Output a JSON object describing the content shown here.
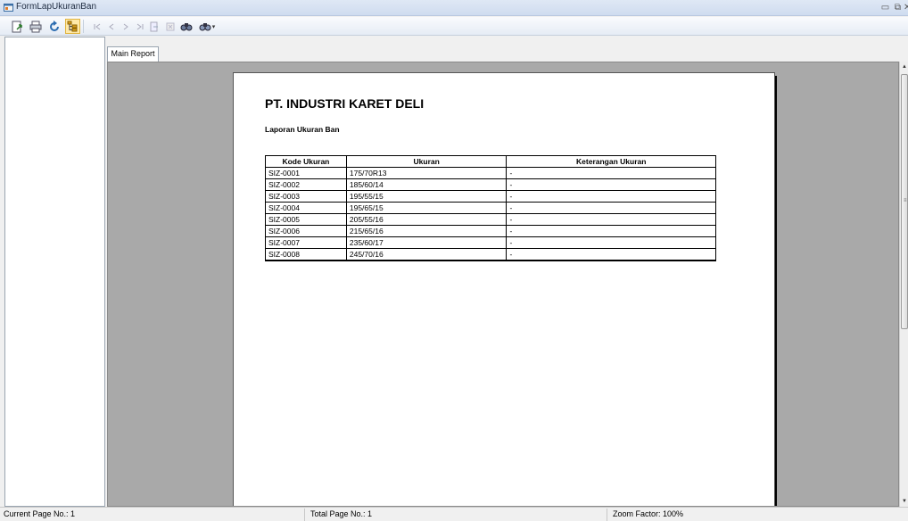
{
  "window": {
    "title": "FormLapUkuranBan",
    "controls": [
      "minimize-icon",
      "restore-icon",
      "close-icon"
    ]
  },
  "toolbar": {
    "buttons": [
      {
        "name": "export-icon",
        "enabled": true
      },
      {
        "name": "print-icon",
        "enabled": true
      },
      {
        "name": "refresh-icon",
        "enabled": true
      },
      {
        "name": "toggle-tree-icon",
        "enabled": true,
        "active": true
      },
      {
        "name": "first-page-icon",
        "enabled": false
      },
      {
        "name": "previous-page-icon",
        "enabled": false
      },
      {
        "name": "next-page-icon",
        "enabled": false
      },
      {
        "name": "last-page-icon",
        "enabled": false
      },
      {
        "name": "goto-page-icon",
        "enabled": false
      },
      {
        "name": "close-view-icon",
        "enabled": false
      },
      {
        "name": "find-icon",
        "enabled": true
      },
      {
        "name": "zoom-icon",
        "enabled": true
      }
    ]
  },
  "tab": {
    "label": "Main Report"
  },
  "report": {
    "company": "PT. INDUSTRI KARET DELI",
    "subtitle": "Laporan Ukuran Ban",
    "columns": [
      "Kode Ukuran",
      "Ukuran",
      "Keterangan Ukuran"
    ],
    "rows": [
      [
        "SIZ-0001",
        "175/70R13",
        "-"
      ],
      [
        "SIZ-0002",
        "185/60/14",
        "-"
      ],
      [
        "SIZ-0003",
        "195/55/15",
        "-"
      ],
      [
        "SIZ-0004",
        "195/65/15",
        "-"
      ],
      [
        "SIZ-0005",
        "205/55/16",
        "-"
      ],
      [
        "SIZ-0006",
        "215/65/16",
        "-"
      ],
      [
        "SIZ-0007",
        "235/60/17",
        "-"
      ],
      [
        "SIZ-0008",
        "245/70/16",
        "-"
      ]
    ]
  },
  "status": {
    "current_page": "Current Page No.: 1",
    "total_page": "Total Page No.: 1",
    "zoom": "Zoom Factor: 100%"
  },
  "colors": {
    "viewport_background": "#a9a9a9",
    "titlebar": "#cfdcef",
    "active_button": "#ffe9a8"
  }
}
